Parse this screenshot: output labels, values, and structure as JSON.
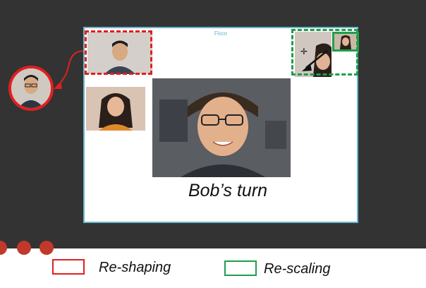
{
  "floor": {
    "label": "Floor"
  },
  "turn_text": "Bob’s turn",
  "legend": {
    "reshaping_label": "Re-shaping",
    "rescaling_label": "Re-scaling"
  },
  "colors": {
    "reshaping": "#e02020",
    "rescaling": "#1f9e4c",
    "floor_border": "#69b7c9",
    "stage": "#333333"
  },
  "icons": {
    "reshape_arrow": "curved-arrow-icon",
    "rescale_arrow": "diagonal-arrow-icon",
    "move_cursor": "move-cursor-icon",
    "mic": "microphone-icon",
    "video": "video-icon",
    "leave": "leave-call-icon"
  }
}
